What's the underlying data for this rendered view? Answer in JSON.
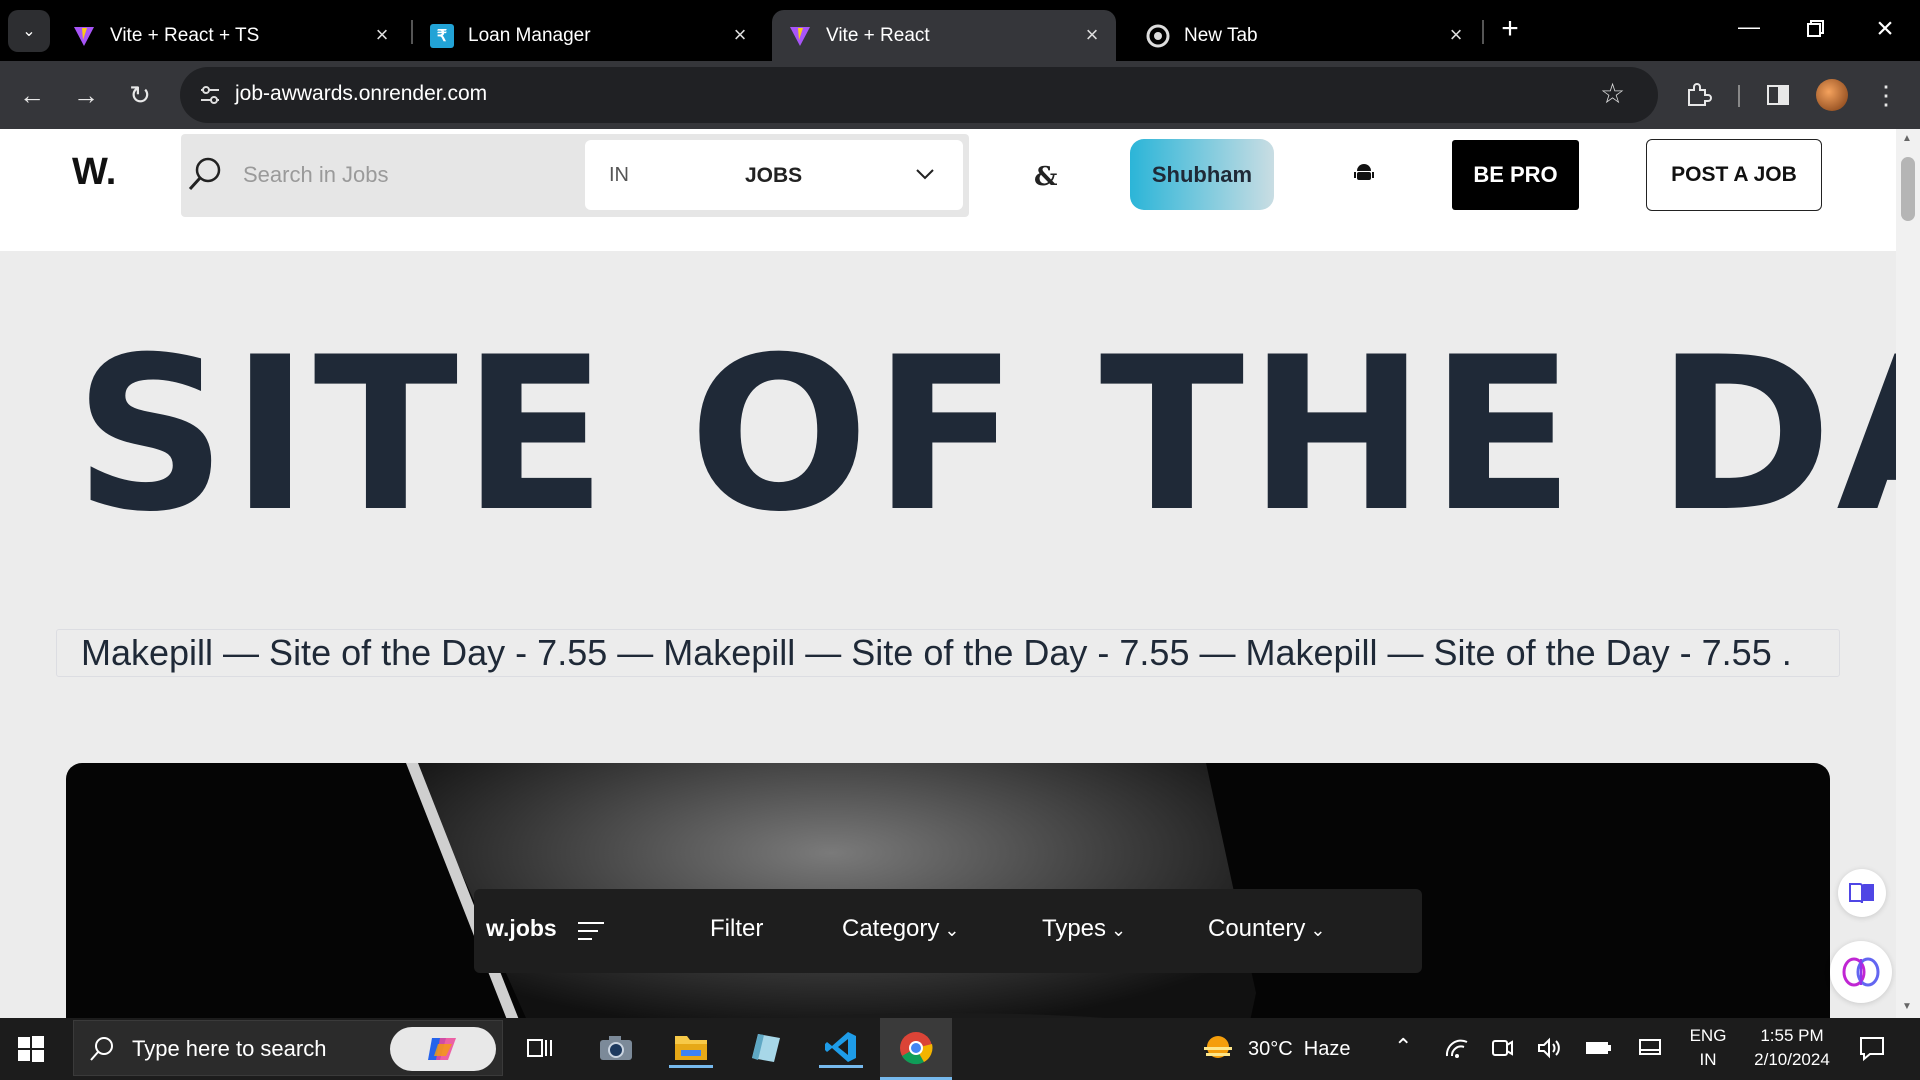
{
  "browser": {
    "tabs": [
      {
        "title": "Vite + React + TS",
        "icon": "vite-icon",
        "active": false
      },
      {
        "title": "Loan Manager",
        "icon": "rupee-icon",
        "active": false
      },
      {
        "title": "Vite + React",
        "icon": "vite-icon",
        "active": true
      },
      {
        "title": "New Tab",
        "icon": "chrome-icon",
        "active": false
      }
    ],
    "url": "job-awwards.onrender.com"
  },
  "header": {
    "logo": "W.",
    "search_placeholder": "Search in Jobs",
    "selector_prefix": "IN",
    "selector_value": "JOBS",
    "ampersand": "&",
    "user_button": "Shubham",
    "pro_button": "BE PRO",
    "post_button": "POST A JOB"
  },
  "hero": {
    "title": "SITE OF THE DAY",
    "marquee": "Makepill — Site of the Day - 7.55 — Makepill — Site of the Day - 7.55 — Makepill — Site of the Day - 7.55 ."
  },
  "navbar": {
    "brand": "w.jobs",
    "items": [
      "Filter",
      "Category",
      "Types",
      "Countery"
    ]
  },
  "taskbar": {
    "search_placeholder": "Type here to search",
    "weather": "30°C  Haze",
    "language": "ENG",
    "region": "IN",
    "time": "1:55 PM",
    "date": "2/10/2024"
  },
  "colors": {
    "hero_text": "#1f2937",
    "user_gradient_start": "#2bb5d8",
    "user_gradient_end": "#c9dde3",
    "pro_bg": "#000000"
  }
}
